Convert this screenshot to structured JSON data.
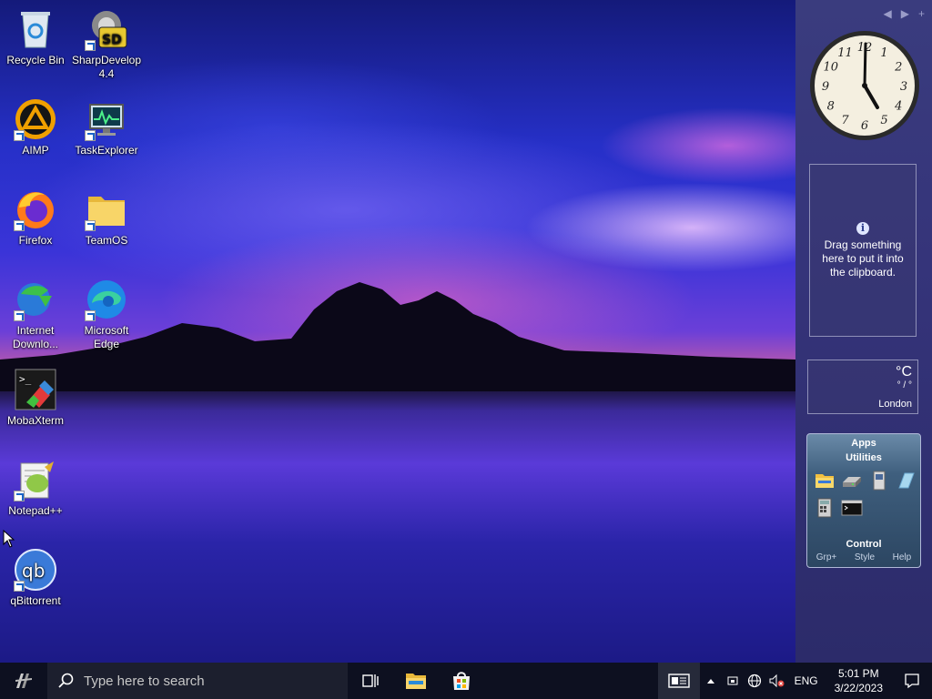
{
  "desktop": {
    "icons": [
      {
        "label": "Recycle Bin",
        "icon": "recycle-bin-icon"
      },
      {
        "label": "SharpDevelop\n4.4",
        "icon": "sharpdevelop-icon"
      },
      {
        "label": "AIMP",
        "icon": "aimp-icon"
      },
      {
        "label": "TaskExplorer",
        "icon": "taskexplorer-icon"
      },
      {
        "label": "Firefox",
        "icon": "firefox-icon"
      },
      {
        "label": "TeamOS",
        "icon": "folder-icon"
      },
      {
        "label": "Internet\nDownlo...",
        "icon": "idm-icon"
      },
      {
        "label": "Microsoft\nEdge",
        "icon": "edge-icon"
      },
      {
        "label": "MobaXterm",
        "icon": "mobaxterm-icon"
      },
      {
        "label": "Notepad++",
        "icon": "notepadpp-icon"
      },
      {
        "label": "qBittorrent",
        "icon": "qbittorrent-icon"
      }
    ]
  },
  "sidebar": {
    "controls": {
      "prev": "◀",
      "next": "▶",
      "add": "+"
    },
    "clock": {
      "numbers": [
        "12",
        "1",
        "2",
        "3",
        "4",
        "5",
        "6",
        "7",
        "8",
        "9",
        "10",
        "11"
      ],
      "time": "5:01"
    },
    "clipboard": {
      "info": "i",
      "text": "Drag something here to put it into the clipboard."
    },
    "weather": {
      "unit": "°C",
      "range": "° / °",
      "city": "London"
    },
    "apps": {
      "title": "Apps",
      "group": "Utilities",
      "control": "Control",
      "links": [
        "Grp+",
        "Style",
        "Help"
      ],
      "tiles": [
        "explorer-icon",
        "drive-icon",
        "device-icon",
        "glass-icon",
        "calculator-icon",
        "console-icon"
      ]
    }
  },
  "taskbar": {
    "search_placeholder": "Type here to search",
    "lang": "ENG",
    "time": "5:01 PM",
    "date": "3/22/2023"
  },
  "colors": {
    "taskbar_bg": "#0d1020",
    "sidebar_bg": "#35347a",
    "accent": "#1a64c8"
  }
}
